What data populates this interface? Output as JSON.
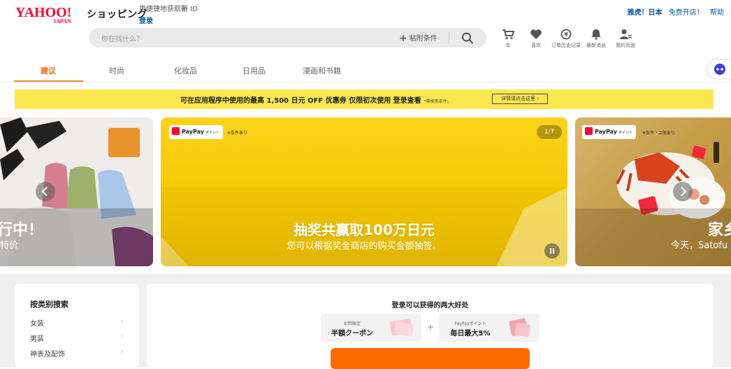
{
  "header": {
    "logo_text": "YAHOO! JAPAN",
    "shopping_label": "ショッピング",
    "login_hint_pre": "更便捷地获取",
    "login_hint_new": "新",
    "login_hint_id": " ID",
    "login_link": "登录",
    "top_links": [
      "雅虎！日本",
      "免费开店！",
      "帮助"
    ]
  },
  "search": {
    "placeholder": "你在找什么？",
    "conditions_label": "粘附条件"
  },
  "icon_nav": [
    {
      "icon": "cart-icon",
      "label": "车"
    },
    {
      "icon": "heart-icon",
      "label": "喜欢"
    },
    {
      "icon": "order-history-icon",
      "label": "订单历史记录"
    },
    {
      "icon": "bell-icon",
      "label": "最新消息"
    },
    {
      "icon": "user-icon",
      "label": "我的页面"
    }
  ],
  "tabs": [
    "建议",
    "时尚",
    "化妆品",
    "日用品",
    "漫画和书籍"
  ],
  "active_tab": "建议",
  "promo": {
    "text": "可在应用程序中使用的最高 1,500 日元 OFF 优惠券 仅限初次使用 登录查看",
    "note": "*需使用条件。",
    "button": "详情请点击这里"
  },
  "carousel": {
    "counter": "1/7",
    "main": {
      "badge": "PayPay",
      "badge_sub": "ポイント",
      "note": "※条件あり",
      "title": "抽奖共赢取100万日元",
      "subtitle": "您可以根据奖金商店的购买金额抽签。"
    },
    "left": {
      "big": "行中！",
      "sub": "特价"
    },
    "right": {
      "badge": "PayPay",
      "badge_sub": "ポイント",
      "note": "※条件・上限あり",
      "big": "家乡",
      "sub": "今天，Satofu"
    }
  },
  "categories": {
    "title": "按类别搜索",
    "items": [
      "女装",
      "男装",
      "神表及配饰"
    ]
  },
  "benefits": {
    "title": "登录可以获得的两大好处",
    "items": [
      {
        "small": "初回限定",
        "big": "半額クーポン"
      },
      {
        "small": "PayPayポイント",
        "big": "毎日最大5%"
      }
    ]
  },
  "colors": {
    "accent_orange": "#e76f0a",
    "link_blue": "#0b57a3",
    "promo_yellow": "#fbe84f",
    "paypay_red": "#ff0033"
  }
}
